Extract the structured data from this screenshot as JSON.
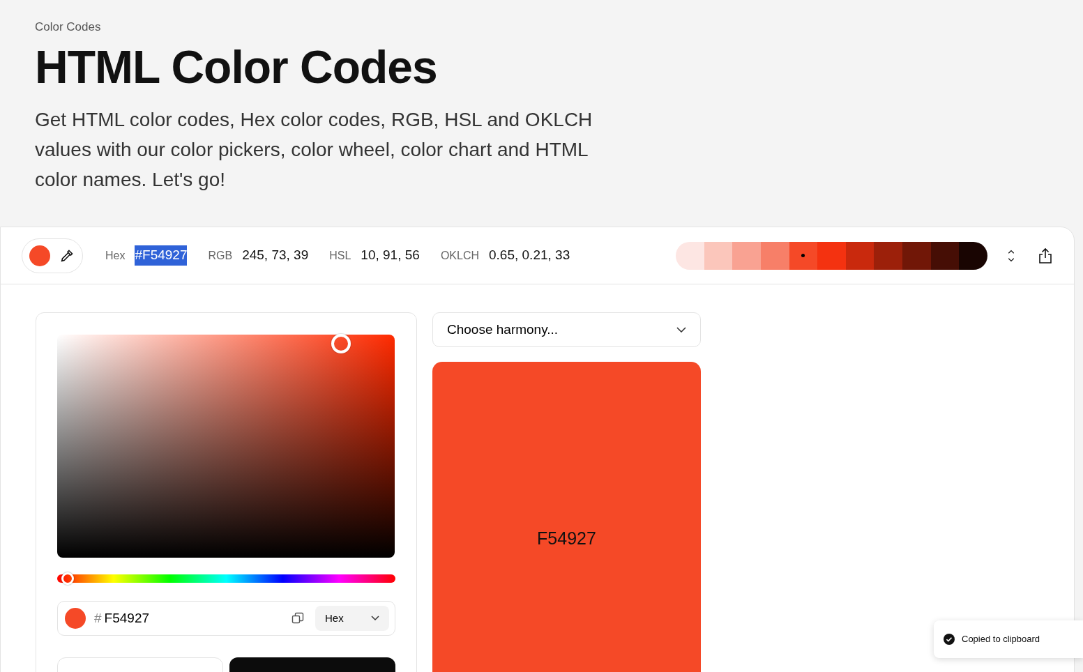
{
  "breadcrumb": "Color Codes",
  "title": "HTML Color Codes",
  "intro": "Get HTML color codes, Hex color codes, RGB, HSL and OKLCH values with our color pickers, color wheel, color chart and HTML color names. Let's go!",
  "toolbar": {
    "values": [
      {
        "label": "Hex",
        "value": "#F54927",
        "selected": true
      },
      {
        "label": "RGB",
        "value": "245, 73, 39",
        "selected": false
      },
      {
        "label": "HSL",
        "value": "10, 91, 56",
        "selected": false
      },
      {
        "label": "OKLCH",
        "value": "0.65, 0.21, 33",
        "selected": false
      }
    ],
    "shades": [
      {
        "color": "#fde6e3",
        "selected": false
      },
      {
        "color": "#fbc6bb",
        "selected": false
      },
      {
        "color": "#f9a292",
        "selected": false
      },
      {
        "color": "#f77f68",
        "selected": false
      },
      {
        "color": "#f54927",
        "selected": true
      },
      {
        "color": "#f43210",
        "selected": false
      },
      {
        "color": "#c9290d",
        "selected": false
      },
      {
        "color": "#9c200a",
        "selected": false
      },
      {
        "color": "#711707",
        "selected": false
      },
      {
        "color": "#460e05",
        "selected": false
      },
      {
        "color": "#190502",
        "selected": false
      }
    ]
  },
  "picker": {
    "hex": "F54927",
    "prefix": "#",
    "format": "Hex"
  },
  "hue_slider": {
    "level": 0.03
  },
  "harmony": {
    "label": "Choose harmony..."
  },
  "swatch": {
    "label": "F54927"
  },
  "toast": {
    "text": "Copied to clipboard"
  }
}
